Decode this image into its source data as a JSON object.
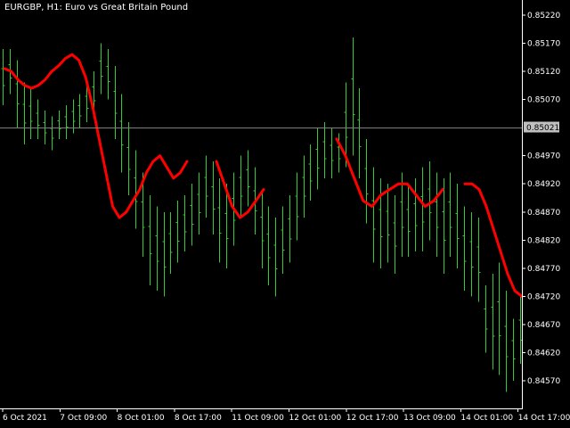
{
  "window": {
    "title": "EURGBP, H1:  Euro vs Great Britain Pound"
  },
  "colors": {
    "background": "#000000",
    "bars": "#33cc33",
    "indicator": "#ff0000",
    "bid_line": "#7f7f7f",
    "bid_tag": "#c0c0c0",
    "axis": "#ffffff"
  },
  "chart_data": {
    "type": "line",
    "symbol": "EURGBP",
    "timeframe": "H1",
    "ylim": [
      0.8452,
      0.8523
    ],
    "price_ticks": [
      "0.85220",
      "0.85170",
      "0.85120",
      "0.85070",
      "0.84970",
      "0.84920",
      "0.84870",
      "0.84820",
      "0.84770",
      "0.84720",
      "0.84670",
      "0.84620",
      "0.84570"
    ],
    "current_bid": "0.85021",
    "time_ticks": [
      "6 Oct 2021",
      "7 Oct 09:00",
      "8 Oct 01:00",
      "8 Oct 17:00",
      "11 Oct 09:00",
      "12 Oct 01:00",
      "12 Oct 17:00",
      "13 Oct 09:00",
      "14 Oct 01:00",
      "14 Oct 17:00"
    ],
    "bars_high_low": [
      [
        0.8516,
        0.8506
      ],
      [
        0.8516,
        0.8508
      ],
      [
        0.8514,
        0.8502
      ],
      [
        0.851,
        0.8499
      ],
      [
        0.8509,
        0.85
      ],
      [
        0.8507,
        0.85
      ],
      [
        0.8505,
        0.8499
      ],
      [
        0.8504,
        0.8498
      ],
      [
        0.8505,
        0.85
      ],
      [
        0.8506,
        0.85
      ],
      [
        0.8507,
        0.8501
      ],
      [
        0.8508,
        0.8502
      ],
      [
        0.851,
        0.8503
      ],
      [
        0.8512,
        0.8504
      ],
      [
        0.8517,
        0.8508
      ],
      [
        0.8516,
        0.8507
      ],
      [
        0.8513,
        0.85
      ],
      [
        0.8508,
        0.8494
      ],
      [
        0.8503,
        0.849
      ],
      [
        0.8498,
        0.8484
      ],
      [
        0.8494,
        0.8479
      ],
      [
        0.849,
        0.8474
      ],
      [
        0.8488,
        0.8473
      ],
      [
        0.8487,
        0.8472
      ],
      [
        0.8487,
        0.8476
      ],
      [
        0.8489,
        0.8478
      ],
      [
        0.849,
        0.848
      ],
      [
        0.8492,
        0.8481
      ],
      [
        0.8494,
        0.8483
      ],
      [
        0.8497,
        0.8486
      ],
      [
        0.8496,
        0.8483
      ],
      [
        0.8493,
        0.8478
      ],
      [
        0.8492,
        0.8477
      ],
      [
        0.8494,
        0.8481
      ],
      [
        0.8497,
        0.8486
      ],
      [
        0.8498,
        0.8488
      ],
      [
        0.8495,
        0.8483
      ],
      [
        0.8491,
        0.8477
      ],
      [
        0.8488,
        0.8474
      ],
      [
        0.8486,
        0.8472
      ],
      [
        0.8488,
        0.8476
      ],
      [
        0.849,
        0.8478
      ],
      [
        0.8494,
        0.8482
      ],
      [
        0.8497,
        0.8486
      ],
      [
        0.8499,
        0.8489
      ],
      [
        0.8502,
        0.8491
      ],
      [
        0.8503,
        0.8493
      ],
      [
        0.8502,
        0.8493
      ],
      [
        0.8501,
        0.8494
      ],
      [
        0.851,
        0.8495
      ],
      [
        0.8518,
        0.8497
      ],
      [
        0.8509,
        0.8493
      ],
      [
        0.85,
        0.8485
      ],
      [
        0.8495,
        0.8478
      ],
      [
        0.8493,
        0.8477
      ],
      [
        0.8492,
        0.8478
      ],
      [
        0.849,
        0.8476
      ],
      [
        0.8494,
        0.8479
      ],
      [
        0.8492,
        0.8479
      ],
      [
        0.8493,
        0.848
      ],
      [
        0.8495,
        0.848
      ],
      [
        0.8496,
        0.8482
      ],
      [
        0.8494,
        0.8479
      ],
      [
        0.8493,
        0.8476
      ],
      [
        0.8494,
        0.8479
      ],
      [
        0.8492,
        0.8477
      ],
      [
        0.8488,
        0.8473
      ],
      [
        0.8487,
        0.8472
      ],
      [
        0.8486,
        0.8471
      ],
      [
        0.8474,
        0.8462
      ],
      [
        0.8476,
        0.8459
      ],
      [
        0.8478,
        0.8458
      ],
      [
        0.8473,
        0.8455
      ],
      [
        0.8468,
        0.8457
      ],
      [
        0.8472,
        0.846
      ]
    ],
    "ma_segments": [
      [
        0.85125,
        0.8512,
        0.85105,
        0.85095,
        0.8509,
        0.85095,
        0.85105,
        0.8512,
        0.8513,
        0.85143,
        0.8515,
        0.8514,
        0.8511,
        0.8506,
        0.85,
        0.8494,
        0.8488,
        0.8486,
        0.8487,
        0.8489,
        0.8491,
        0.8494,
        0.8496,
        0.8497,
        0.8495,
        0.8493,
        0.8494,
        0.8496
      ],
      [
        0.8496,
        0.8492,
        0.8488,
        0.8486,
        0.8487,
        0.8489,
        0.8491
      ],
      [
        0.85,
        0.8497,
        0.8493,
        0.8489,
        0.8488,
        0.849,
        0.8491,
        0.8492,
        0.8492,
        0.849,
        0.8488,
        0.8489,
        0.8491
      ],
      [
        0.8492,
        0.8492,
        0.8491,
        0.8488,
        0.8484,
        0.848,
        0.8476,
        0.8473,
        0.8472
      ]
    ]
  }
}
